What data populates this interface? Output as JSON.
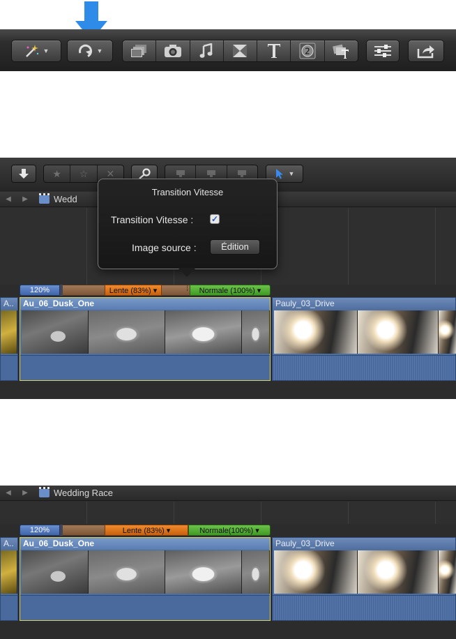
{
  "toolbar_top": {
    "buttons": [
      {
        "name": "enhance-button",
        "icon": "magic-wand-icon",
        "has_menu": true
      },
      {
        "name": "retime-button",
        "icon": "retime-icon",
        "has_menu": true
      }
    ],
    "browsers": [
      "film-browser-icon",
      "camera-icon",
      "music-note-icon",
      "transition-icon",
      "title-text-icon",
      "generator-icon",
      "themes-icon"
    ],
    "inspector_icon": "inspector-sliders-icon",
    "share_icon": "share-icon",
    "highlight_color": "#2e8ce8"
  },
  "toolbar_timeline": {
    "import_icon": "import-arrow-icon",
    "ratings": [
      "star-filled-icon",
      "star-outline-icon",
      "reject-x-icon"
    ],
    "search_icon": "keyword-key-icon",
    "edit_buttons": [
      "connect-icon",
      "insert-icon",
      "append-icon"
    ],
    "tool_icon": "select-arrow-icon"
  },
  "panel_a": {
    "nav_prefix": "Wedd",
    "popover": {
      "title": "Transition Vitesse",
      "checkbox_label": "Transition Vitesse :",
      "checkbox_checked": true,
      "source_label": "Image source :",
      "source_button": "Édition"
    },
    "speed": {
      "fast": "120%",
      "slow": "Lente (83%) ▾",
      "normal": "Normale (100%) ▾",
      "handle": "⁞"
    },
    "prev_clip": "A..",
    "clip1": "Au_06_Dusk_One",
    "clip2": "Pauly_03_Drive"
  },
  "panel_b": {
    "project": "Wedding Race",
    "speed": {
      "fast": "120%",
      "slow": "Lente (83%) ▾",
      "normal": "Normale(100%) ▾"
    },
    "prev_clip": "A..",
    "clip1": "Au_06_Dusk_One",
    "clip2": "Pauly_03_Drive"
  }
}
